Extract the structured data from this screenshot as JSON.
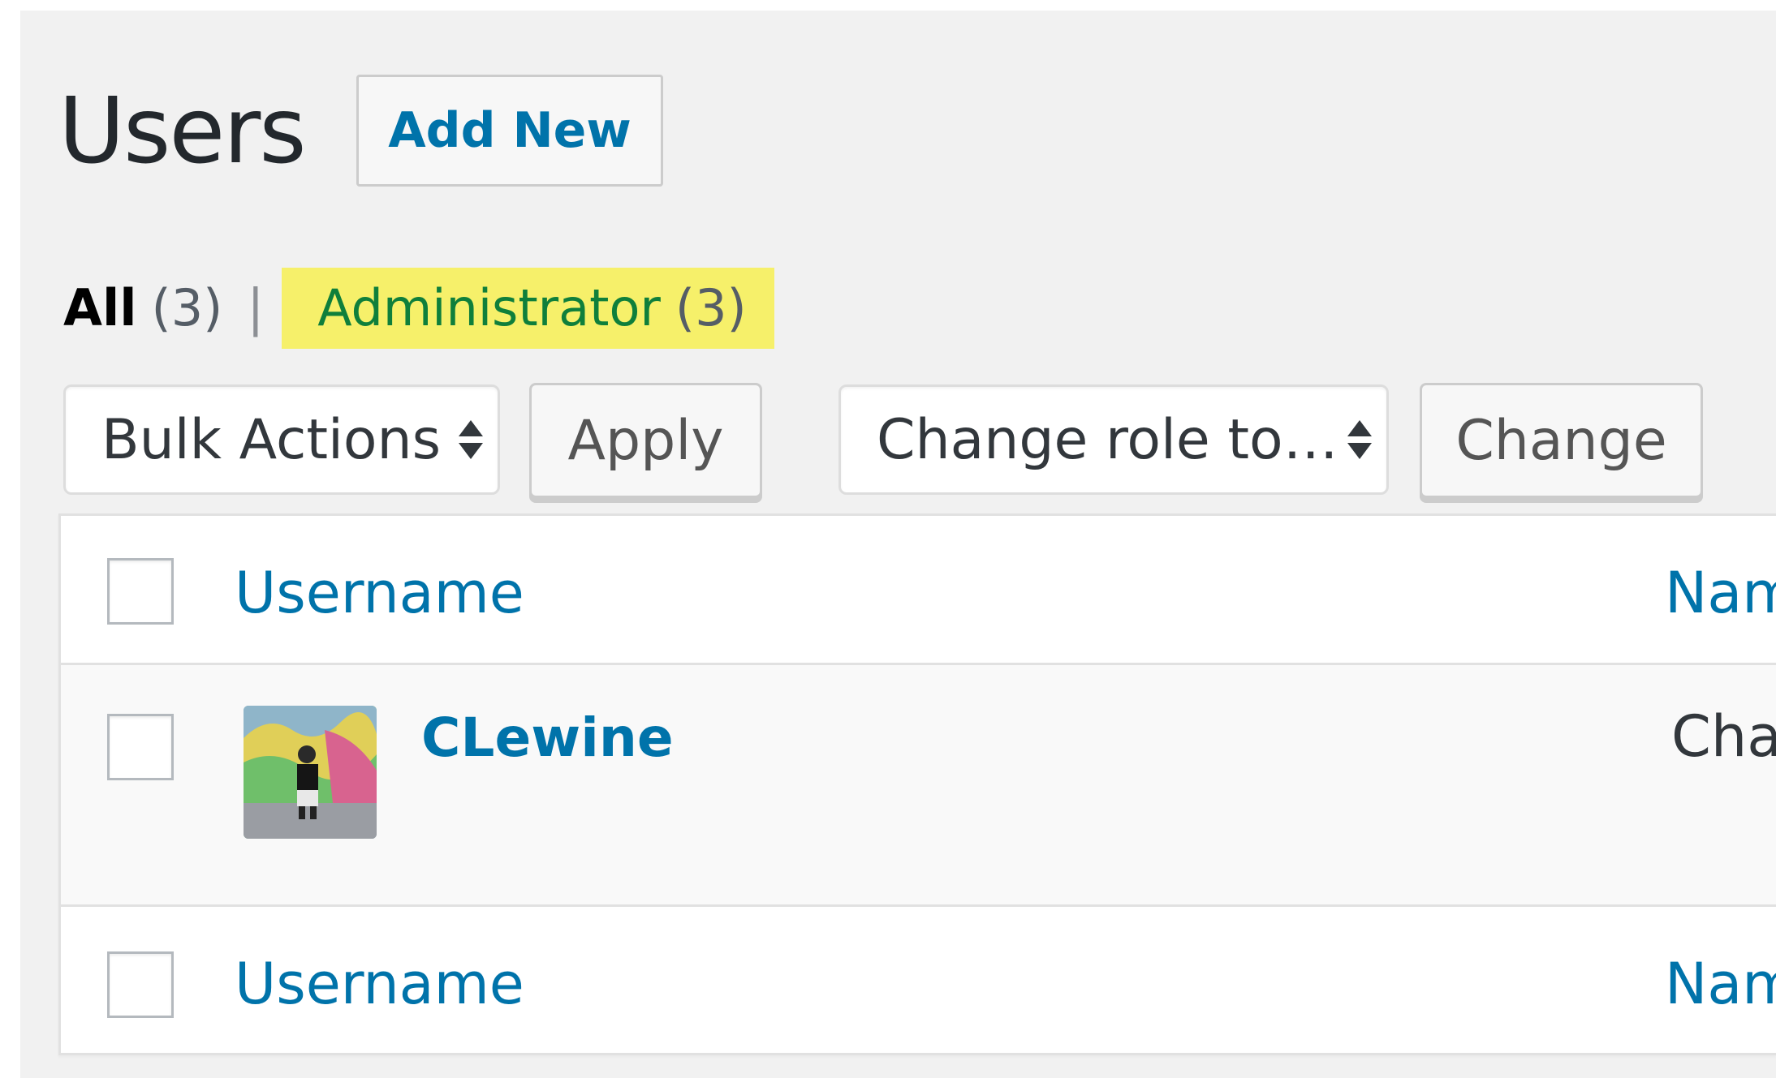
{
  "header": {
    "title": "Users",
    "add_new_label": "Add New"
  },
  "views": {
    "all_label": "All",
    "all_count": "(3)",
    "separator": "|",
    "administrator_label": "Administrator",
    "administrator_count": "(3)"
  },
  "bulk_actions": {
    "select_value": "Bulk Actions",
    "apply_label": "Apply"
  },
  "change_role": {
    "select_value": "Change role to…",
    "change_label": "Change"
  },
  "table": {
    "columns": {
      "username": "Username",
      "name": "Nam"
    },
    "rows": [
      {
        "username": "CLewine",
        "name": "Cha"
      }
    ],
    "footer": {
      "username": "Username",
      "name": "Nam"
    }
  },
  "colors": {
    "link": "#0073aa",
    "highlight": "#f6f06a",
    "admin_text": "#0f7f3b",
    "page_background": "#f1f1f1"
  },
  "icons": {
    "select_arrows": "select-arrows-icon",
    "avatar": "user-avatar-image"
  }
}
